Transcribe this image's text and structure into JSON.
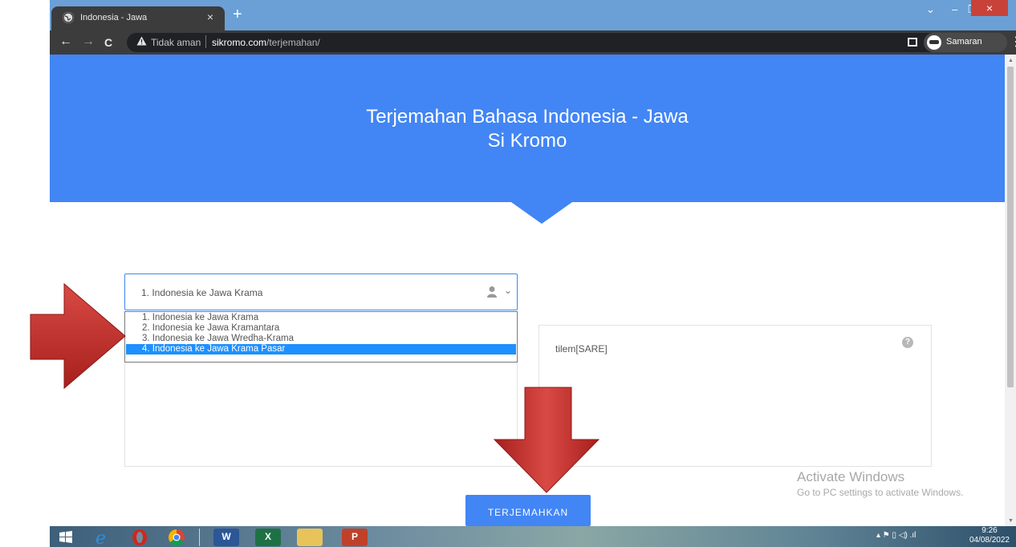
{
  "browser": {
    "tab_title": "Indonesia - Jawa",
    "tab_close": "×",
    "new_tab": "+",
    "security_label": "Tidak aman",
    "url_domain": "sikromo.com",
    "url_path": "/terjemahan/",
    "profile_label": "Samaran",
    "window_controls": {
      "collapse": "⌄",
      "minimize": "–",
      "maximize": "❐",
      "close": "×"
    },
    "nav": {
      "back": "←",
      "forward": "→",
      "reload": "C"
    },
    "icons": [
      "globe-icon",
      "warning-icon",
      "star-icon",
      "side-panel-icon",
      "incognito-icon",
      "kebab-menu-icon"
    ]
  },
  "page": {
    "hero_title": "Terjemahan Bahasa Indonesia - Jawa",
    "hero_subtitle": "Si Kromo",
    "select_value": "1. Indonesia ke Jawa Krama",
    "options": [
      "1. Indonesia ke Jawa Krama",
      "2. Indonesia ke Jawa Kramantara",
      "3. Indonesia ke Jawa Wredha-Krama",
      "4. Indonesia ke Jawa Krama Pasar"
    ],
    "selected_option_index": 3,
    "output_text": "tilem[SARE]",
    "help_icon": "?",
    "submit_label": "TERJEMAHKAN",
    "accent_color": "#4285f4"
  },
  "watermark": {
    "title": "Activate Windows",
    "subtitle": "Go to PC settings to activate Windows."
  },
  "taskbar": {
    "time": "9:26",
    "date": "04/08/2022",
    "apps": [
      "windows-start-icon",
      "internet-explorer-icon",
      "opera-icon",
      "chrome-icon",
      "word-icon",
      "excel-icon",
      "file-explorer-icon",
      "powerpoint-icon"
    ]
  }
}
